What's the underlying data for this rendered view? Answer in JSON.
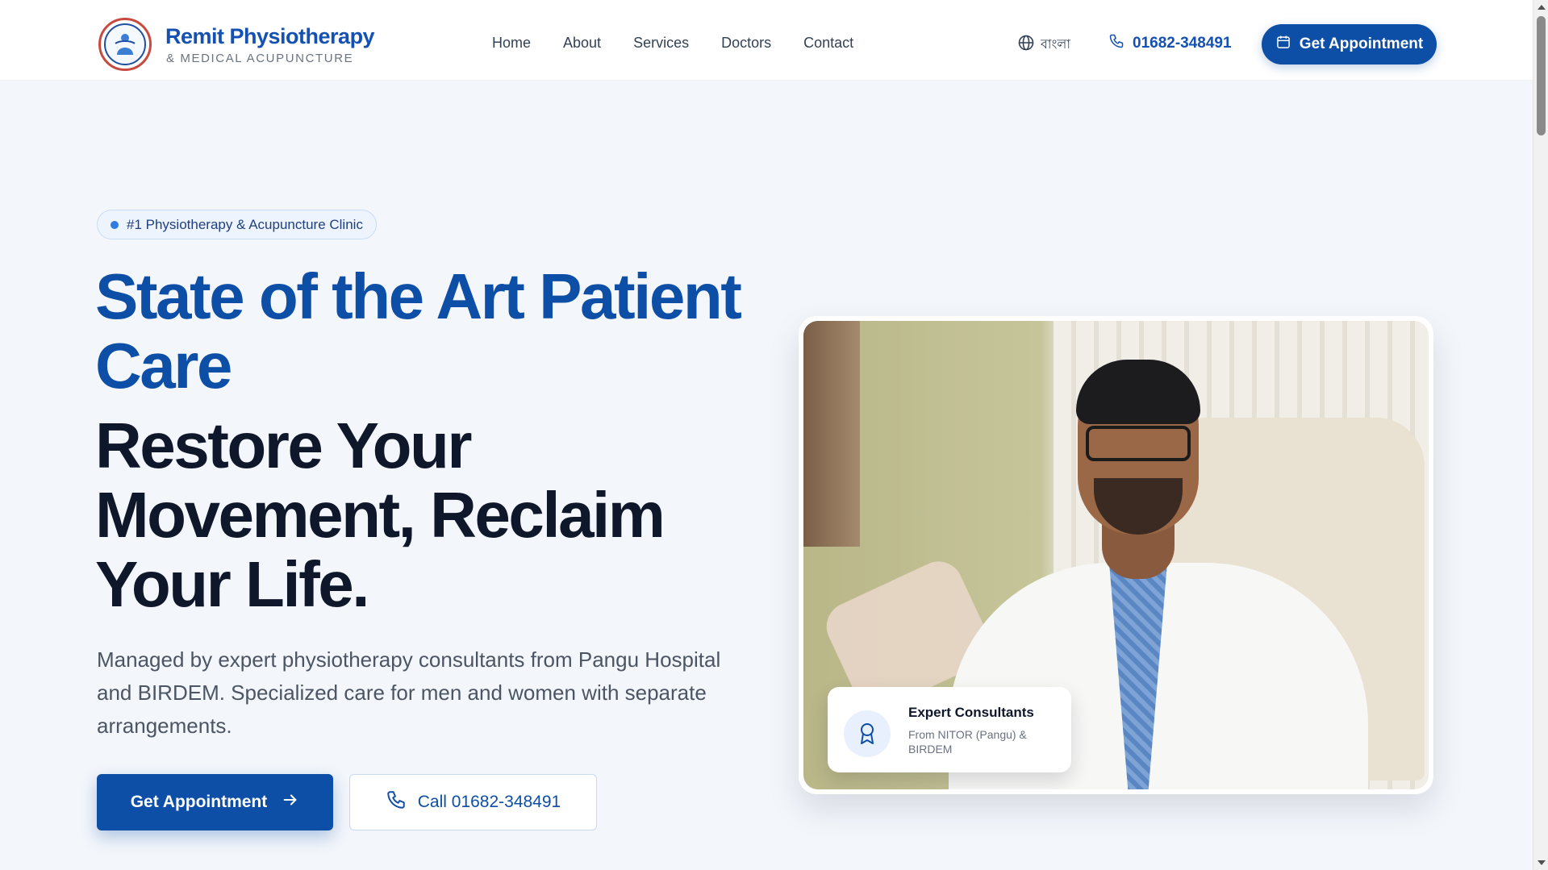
{
  "brand": {
    "name": "Remit Physiotherapy",
    "subtitle": "& MEDICAL ACUPUNCTURE"
  },
  "nav": {
    "items": [
      {
        "label": "Home"
      },
      {
        "label": "About"
      },
      {
        "label": "Services"
      },
      {
        "label": "Doctors"
      },
      {
        "label": "Contact"
      }
    ]
  },
  "header": {
    "language_label": "বাংলা",
    "phone": "01682-348491",
    "appointment_label": "Get Appointment"
  },
  "hero": {
    "badge": "#1 Physiotherapy & Acupuncture Clinic",
    "headline_blue": "State of the Art Patient Care",
    "headline_dark": "Restore Your Movement, Reclaim Your Life.",
    "description": "Managed by expert physiotherapy consultants from Pangu Hospital and BIRDEM. Specialized care for men and women with separate arrangements.",
    "primary_button": "Get Appointment",
    "secondary_button": "Call 01682-348491"
  },
  "info_card": {
    "title": "Expert Consultants",
    "subtitle": "From NITOR (Pangu) & BIRDEM"
  },
  "icons": {
    "logo": "clinic-logo-icon",
    "language": "globe-icon",
    "phone": "phone-icon",
    "calendar": "calendar-icon",
    "arrow": "arrow-right-icon",
    "award": "award-icon"
  },
  "colors": {
    "primary": "#0d4ea6",
    "accent_dot": "#2f7be0",
    "headline_dark": "#0f172a",
    "background": "#f3f6fb"
  }
}
